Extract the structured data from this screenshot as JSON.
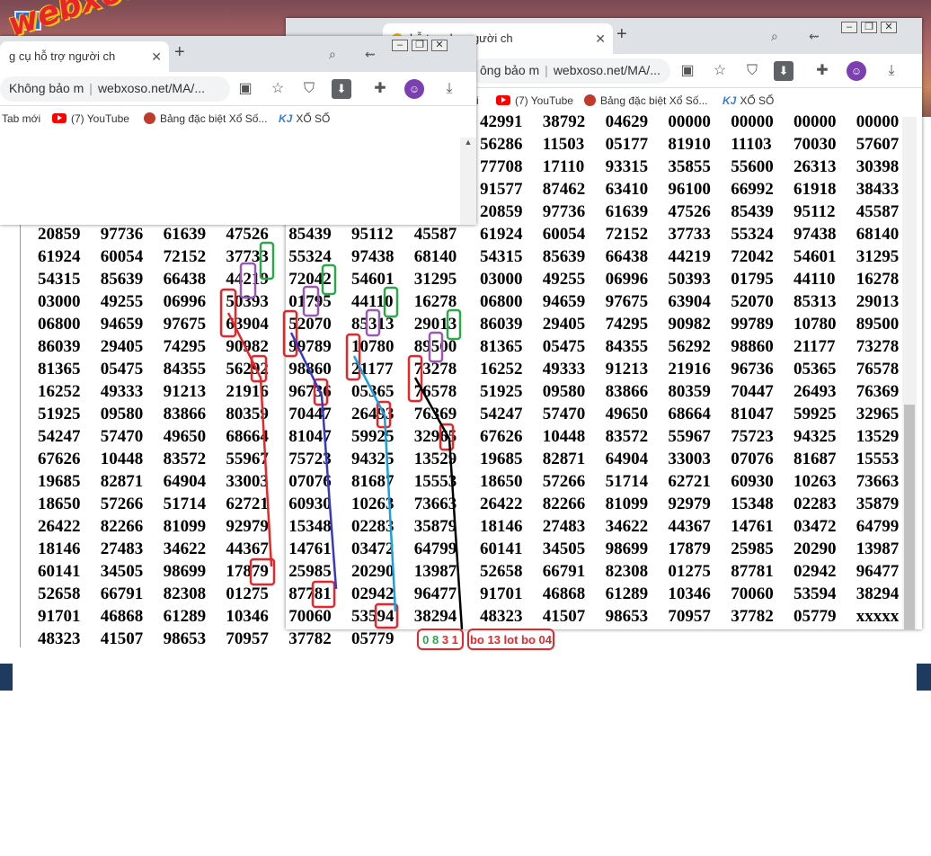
{
  "watermark": "webxoso.net",
  "back_window": {
    "tab_title": "hỗ trợ cho người ch",
    "url_security": "ông bảo m",
    "url": "webxoso.net/MA/...",
    "bookmarks": [
      "i",
      "(7) YouTube",
      "Bảng đặc biệt Xổ Số...",
      "XỔ SỐ"
    ]
  },
  "front_window": {
    "tab_title": "g cụ hỗ trợ người ch",
    "url_security": "Không bảo m",
    "url": "webxoso.net/MA/...",
    "bookmarks": [
      "Tab mới",
      "(7) YouTube",
      "Bảng đặc biệt Xổ Số...",
      "XỔ SỐ"
    ]
  },
  "icons": {
    "kj_logo": "KJ",
    "avatar": "avatar-icon",
    "download": "download-icon"
  },
  "left_grid": [
    [
      "42991",
      "38792",
      "04629",
      "00000",
      "00000",
      "00000",
      "00000"
    ],
    [
      "56286",
      "11503",
      "05177",
      "81910",
      "11103",
      "70030",
      "57607"
    ],
    [
      "77708",
      "17110",
      "93315",
      "35855",
      "55600",
      "26313",
      "30398"
    ],
    [
      "91577",
      "87462",
      "63410",
      "96100",
      "66992",
      "61918",
      "38433"
    ],
    [
      "20859",
      "97736",
      "61639",
      "47526",
      "85439",
      "95112",
      "45587"
    ],
    [
      "61924",
      "60054",
      "72152",
      "37733",
      "55324",
      "97438",
      "68140"
    ],
    [
      "54315",
      "85639",
      "66438",
      "44219",
      "72042",
      "54601",
      "31295"
    ],
    [
      "03000",
      "49255",
      "06996",
      "50393",
      "01795",
      "44110",
      "16278"
    ],
    [
      "06800",
      "94659",
      "97675",
      "63904",
      "52070",
      "85313",
      "29013"
    ],
    [
      "86039",
      "29405",
      "74295",
      "90982",
      "99789",
      "10780",
      "89500"
    ],
    [
      "81365",
      "05475",
      "84355",
      "56292",
      "98860",
      "21177",
      "73278"
    ],
    [
      "16252",
      "49333",
      "91213",
      "21916",
      "96736",
      "05365",
      "76578"
    ],
    [
      "51925",
      "09580",
      "83866",
      "80359",
      "70447",
      "26493",
      "76369"
    ],
    [
      "54247",
      "57470",
      "49650",
      "68664",
      "81047",
      "59925",
      "32965"
    ],
    [
      "67626",
      "10448",
      "83572",
      "55967",
      "75723",
      "94325",
      "13529"
    ],
    [
      "19685",
      "82871",
      "64904",
      "33003",
      "07076",
      "81687",
      "15553"
    ],
    [
      "18650",
      "57266",
      "51714",
      "62721",
      "60930",
      "10263",
      "73663"
    ],
    [
      "26422",
      "82266",
      "81099",
      "92979",
      "15348",
      "02283",
      "35879"
    ],
    [
      "18146",
      "27483",
      "34622",
      "44367",
      "14761",
      "03472",
      "64799"
    ],
    [
      "60141",
      "34505",
      "98699",
      "17879",
      "25985",
      "20290",
      "13987"
    ],
    [
      "52658",
      "66791",
      "82308",
      "01275",
      "87781",
      "02942",
      "96477"
    ],
    [
      "91701",
      "46868",
      "61289",
      "10346",
      "70060",
      "53594",
      "38294"
    ],
    [
      "48323",
      "41507",
      "98653",
      "70957",
      "37782",
      "05779",
      ""
    ]
  ],
  "right_grid": [
    [
      "42991",
      "38792",
      "04629",
      "00000",
      "00000",
      "00000",
      "00000"
    ],
    [
      "56286",
      "11503",
      "05177",
      "81910",
      "11103",
      "70030",
      "57607"
    ],
    [
      "77708",
      "17110",
      "93315",
      "35855",
      "55600",
      "26313",
      "30398"
    ],
    [
      "91577",
      "87462",
      "63410",
      "96100",
      "66992",
      "61918",
      "38433"
    ],
    [
      "20859",
      "97736",
      "61639",
      "47526",
      "85439",
      "95112",
      "45587"
    ],
    [
      "61924",
      "60054",
      "72152",
      "37733",
      "55324",
      "97438",
      "68140"
    ],
    [
      "54315",
      "85639",
      "66438",
      "44219",
      "72042",
      "54601",
      "31295"
    ],
    [
      "03000",
      "49255",
      "06996",
      "50393",
      "01795",
      "44110",
      "16278"
    ],
    [
      "06800",
      "94659",
      "97675",
      "63904",
      "52070",
      "85313",
      "29013"
    ],
    [
      "86039",
      "29405",
      "74295",
      "90982",
      "99789",
      "10780",
      "89500"
    ],
    [
      "81365",
      "05475",
      "84355",
      "56292",
      "98860",
      "21177",
      "73278"
    ],
    [
      "16252",
      "49333",
      "91213",
      "21916",
      "96736",
      "05365",
      "76578"
    ],
    [
      "51925",
      "09580",
      "83866",
      "80359",
      "70447",
      "26493",
      "76369"
    ],
    [
      "54247",
      "57470",
      "49650",
      "68664",
      "81047",
      "59925",
      "32965"
    ],
    [
      "67626",
      "10448",
      "83572",
      "55967",
      "75723",
      "94325",
      "13529"
    ],
    [
      "19685",
      "82871",
      "64904",
      "33003",
      "07076",
      "81687",
      "15553"
    ],
    [
      "18650",
      "57266",
      "51714",
      "62721",
      "60930",
      "10263",
      "73663"
    ],
    [
      "26422",
      "82266",
      "81099",
      "92979",
      "15348",
      "02283",
      "35879"
    ],
    [
      "18146",
      "27483",
      "34622",
      "44367",
      "14761",
      "03472",
      "64799"
    ],
    [
      "60141",
      "34505",
      "98699",
      "17879",
      "25985",
      "20290",
      "13987"
    ],
    [
      "52658",
      "66791",
      "82308",
      "01275",
      "87781",
      "02942",
      "96477"
    ],
    [
      "91701",
      "46868",
      "61289",
      "10346",
      "70060",
      "53594",
      "38294"
    ],
    [
      "48323",
      "41507",
      "98653",
      "70957",
      "37782",
      "05779",
      "xxxxx"
    ]
  ],
  "annotation_digits": [
    {
      "d": "0",
      "color": "#2ba84a"
    },
    {
      "d": "8",
      "color": "#2ba84a"
    },
    {
      "d": "3",
      "color": "#e8262a"
    },
    {
      "d": "1",
      "color": "#e8262a"
    }
  ],
  "annotation_note": "bo 13 lot bo 04"
}
